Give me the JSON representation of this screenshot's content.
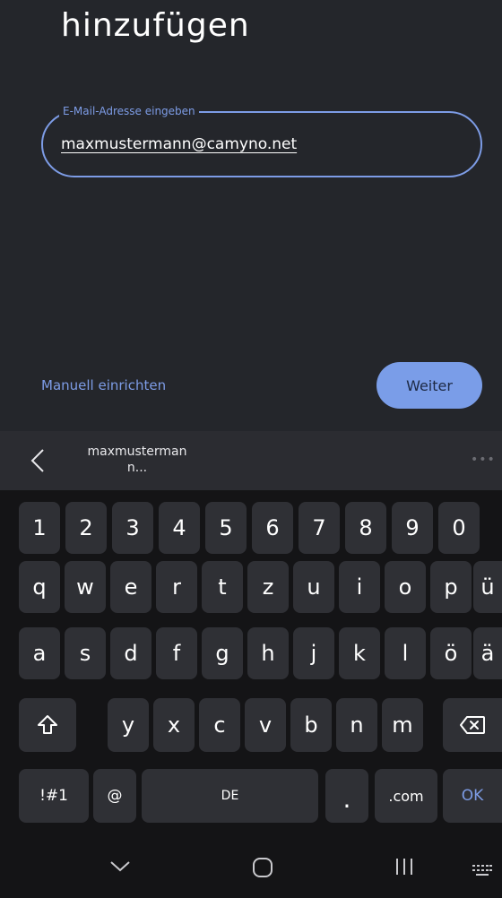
{
  "page": {
    "title": "hinzufügen",
    "email_field": {
      "label": "E-Mail-Adresse eingeben",
      "value": "maxmustermann@camyno.net"
    },
    "manual_setup_label": "Manuell einrichten",
    "next_label": "Weiter"
  },
  "suggestion_bar": {
    "suggestion_line1": "maxmusterman",
    "suggestion_line2": "n..."
  },
  "keyboard": {
    "numbers": [
      "1",
      "2",
      "3",
      "4",
      "5",
      "6",
      "7",
      "8",
      "9",
      "0"
    ],
    "row1": [
      "q",
      "w",
      "e",
      "r",
      "t",
      "z",
      "u",
      "i",
      "o",
      "p",
      "ü"
    ],
    "row2": [
      "a",
      "s",
      "d",
      "f",
      "g",
      "h",
      "j",
      "k",
      "l",
      "ö",
      "ä"
    ],
    "row3": [
      "y",
      "x",
      "c",
      "v",
      "b",
      "n",
      "m"
    ],
    "symbols_label": "!#1",
    "at_label": "@",
    "space_label": "DE",
    "period_label": ".",
    "dotcom_label": ".com",
    "ok_label": "OK"
  },
  "colors": {
    "accent": "#7d9ce6",
    "background": "#24262b",
    "keyboard_bg": "#141416",
    "key_bg": "#2f3035"
  }
}
